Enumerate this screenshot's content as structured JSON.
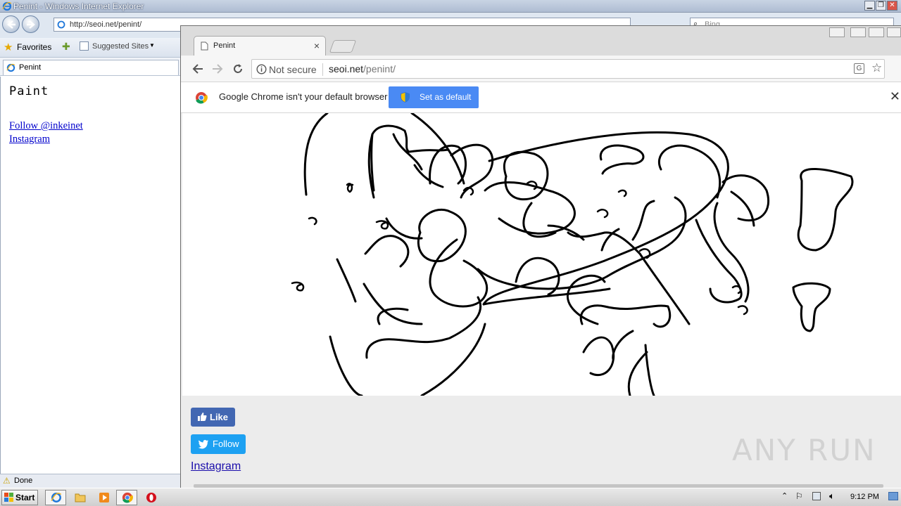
{
  "ie": {
    "title": "Penint - Windows Internet Explorer",
    "address": "http://seoi.net/penint/",
    "search_placeholder": "Bing",
    "favorites_label": "Favorites",
    "suggested_sites_label": "Suggested Sites",
    "tab_title": "Penint",
    "page": {
      "heading": "Paint",
      "links": [
        "Follow @inkeinet",
        "Instagram"
      ]
    },
    "status": "Done"
  },
  "chrome": {
    "tab_title": "Penint",
    "security_label": "Not secure",
    "url_domain": "seoi.net",
    "url_path": "/penint/",
    "infobar": {
      "message": "Google Chrome isn't your default browser",
      "button_label": "Set as default"
    },
    "page": {
      "like_label": "Like",
      "follow_label": "Follow",
      "instagram_label": "Instagram"
    }
  },
  "watermark": "ANY RUN",
  "taskbar": {
    "start_label": "Start",
    "clock": "9:12 PM"
  },
  "colors": {
    "like_button": "#4267b2",
    "follow_button": "#1da1f2",
    "set_default_button": "#4a8af4",
    "link": "#1a0dab"
  }
}
